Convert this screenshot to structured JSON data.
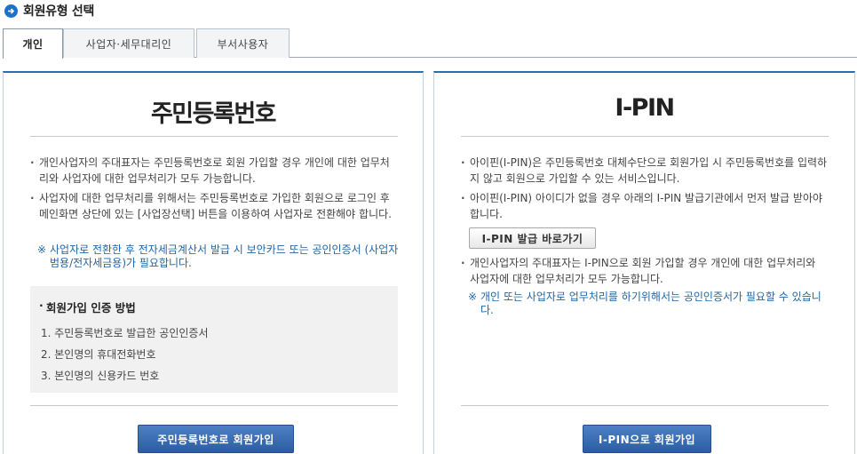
{
  "header": {
    "title": "회원유형 선택",
    "icon": "arrow-right-circle-icon",
    "accent": "#1a73c9"
  },
  "tabs": [
    {
      "label": "개인",
      "active": true
    },
    {
      "label": "사업자·세무대리인",
      "active": false
    },
    {
      "label": "부서사용자",
      "active": false
    }
  ],
  "left": {
    "title": "주민등록번호",
    "bullets": [
      "개인사업자의 주대표자는 주민등록번호로 회원 가입할 경우 개인에 대한 업무처리와 사업자에 대한 업무처리가 모두 가능합니다.",
      "사업자에 대한 업무처리를 위해서는 주민등록번호로 가입한 회원으로 로그인 후 메인화면 상단에 있는 [사업장선택] 버튼을 이용하여 사업자로 전환해야 합니다."
    ],
    "note_mark": "※",
    "note": "사업자로 전환한 후 전자세금계산서 발급 시 보안카드 또는 공인인증서 (사업자범용/전자세금용)가 필요합니다.",
    "auth_title": "회원가입 인증 방법",
    "auth_items": [
      "1. 주민등록번호로 발급한 공인인증서",
      "2. 본인명의 휴대전화번호",
      "3. 본인명의 신용카드 번호"
    ],
    "button": "주민등록번호로 회원가입"
  },
  "right": {
    "title": "I-PIN",
    "bullets": [
      "아이핀(I-PIN)은 주민등록번호 대체수단으로 회원가입 시 주민등록번호를 입력하지 않고 회원으로 가입할 수 있는 서비스입니다.",
      "아이핀(I-PIN) 아이디가 없을 경우 아래의 I-PIN 발급기관에서 먼저 발급 받아야 합니다."
    ],
    "issue_button": "I-PIN 발급 바로가기",
    "bullets2": [
      "개인사업자의 주대표자는 I-PIN으로 회원 가입할 경우 개인에 대한 업무처리와 사업자에 대한 업무처리가 모두 가능합니다."
    ],
    "note_mark": "※",
    "note": "개인 또는 사업자로 업무처리를 하기위해서는 공인인증서가 필요할 수 있습니다.",
    "button": "I-PIN으로 회원가입"
  }
}
